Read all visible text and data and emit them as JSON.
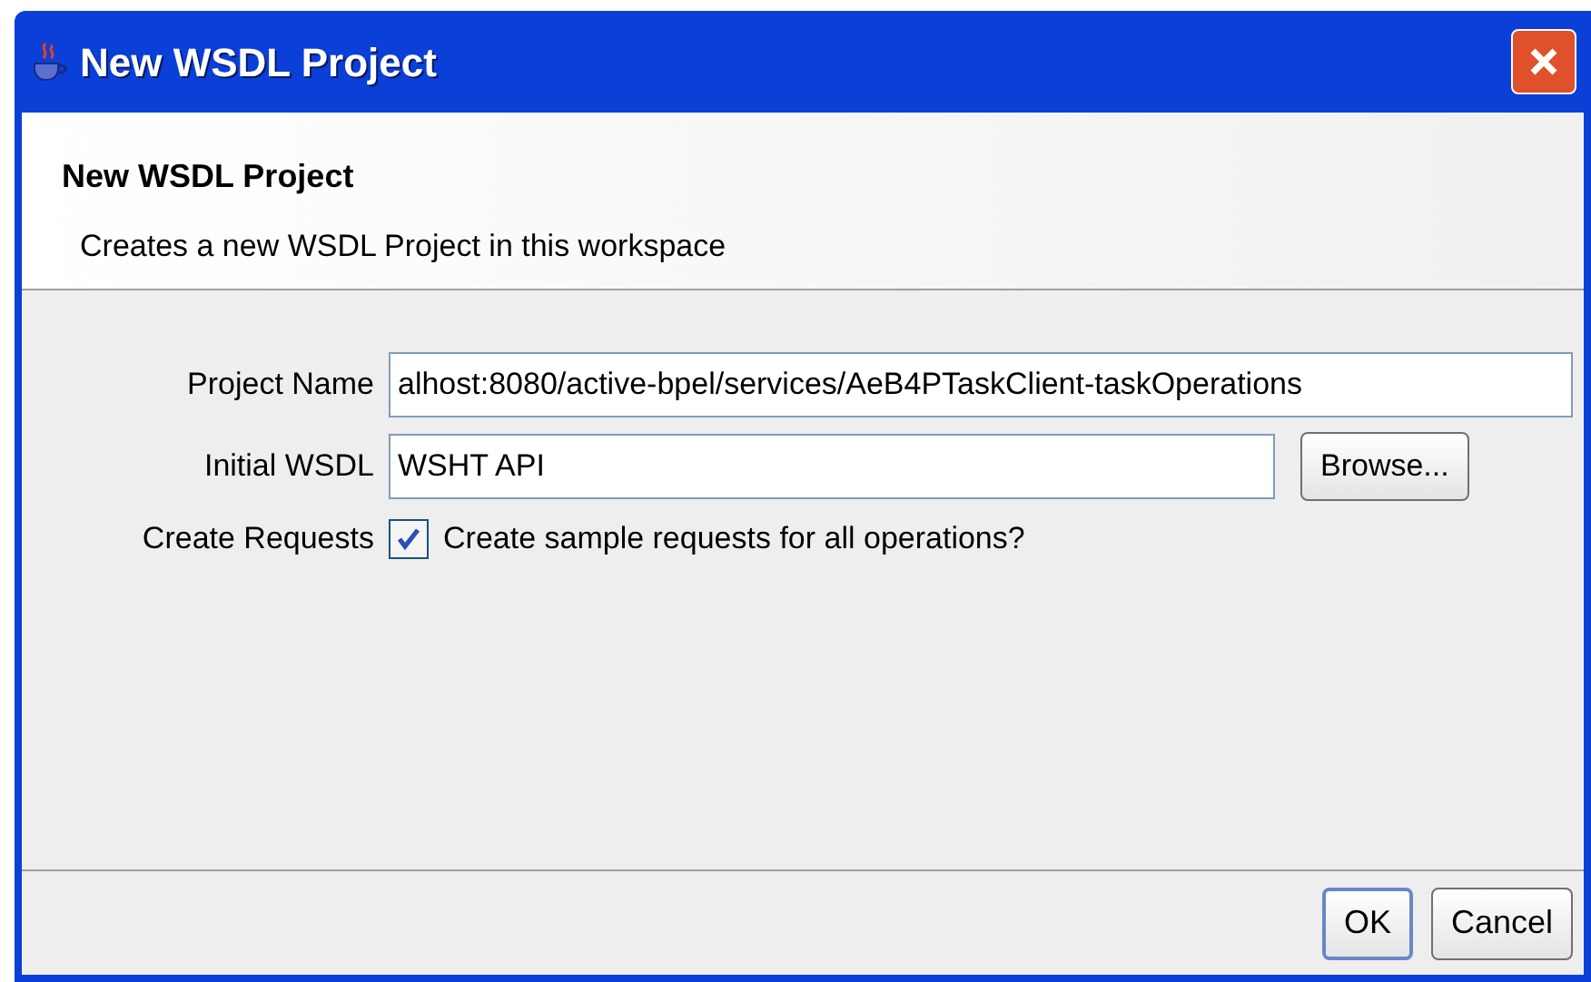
{
  "window": {
    "title": "New WSDL Project"
  },
  "header": {
    "title": "New WSDL Project",
    "description": "Creates a new WSDL Project in this workspace"
  },
  "form": {
    "project_name": {
      "label": "Project Name",
      "value": "alhost:8080/active-bpel/services/AeB4PTaskClient-taskOperations"
    },
    "initial_wsdl": {
      "label": "Initial WSDL",
      "value": "WSHT API",
      "button": "Browse..."
    },
    "create_requests": {
      "label": "Create Requests",
      "checkbox_label": "Create sample requests for all operations?",
      "checked": true
    }
  },
  "buttons": [
    {
      "label": "OK",
      "default": true
    },
    {
      "label": "Cancel",
      "default": false
    }
  ]
}
